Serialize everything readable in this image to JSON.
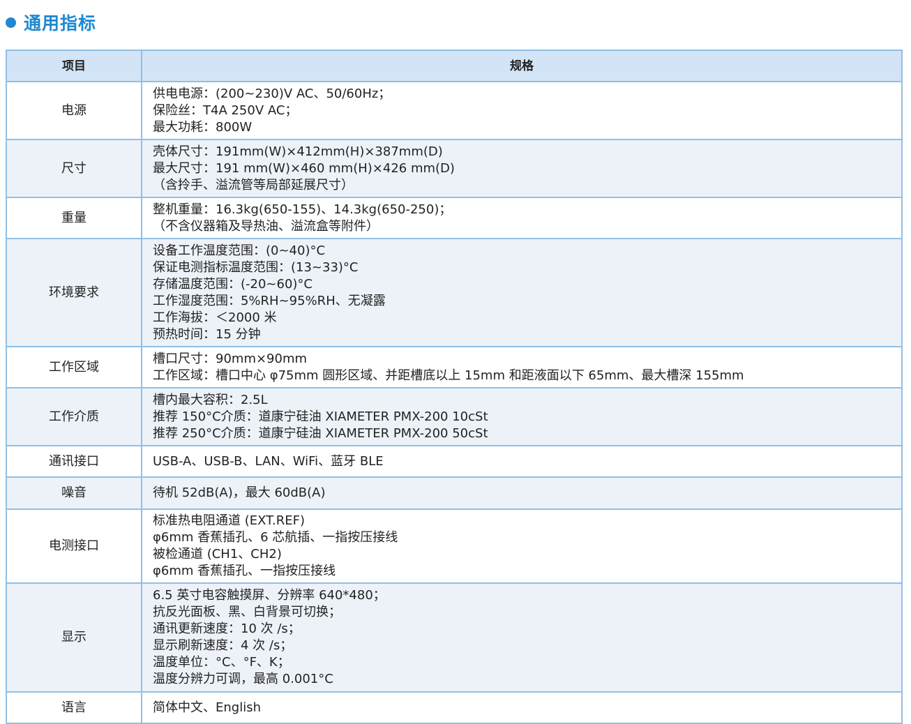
{
  "title": "通用指标",
  "accent": "#1e88d0",
  "header": {
    "item": "项目",
    "spec": "规格"
  },
  "rows": [
    {
      "item": "电源",
      "lines": [
        "供电电源：(200~230)V AC、50/60Hz；",
        "保险丝：T4A 250V AC；",
        "最大功耗：800W"
      ]
    },
    {
      "item": "尺寸",
      "lines": [
        "壳体尺寸：191mm(W)×412mm(H)×387mm(D)",
        "最大尺寸：191 mm(W)×460 mm(H)×426 mm(D)",
        "（含拎手、溢流管等局部延展尺寸）"
      ]
    },
    {
      "item": "重量",
      "lines": [
        "整机重量：16.3kg(650-155)、14.3kg(650-250)；",
        "（不含仪器箱及导热油、溢流盒等附件）"
      ]
    },
    {
      "item": "环境要求",
      "lines": [
        "设备工作温度范围：(0~40)°C",
        "保证电测指标温度范围：(13~33)°C",
        "存储温度范围：(-20~60)°C",
        "工作湿度范围：5%RH~95%RH、无凝露",
        "工作海拔：＜2000 米",
        "预热时间：15 分钟"
      ]
    },
    {
      "item": "工作区域",
      "lines": [
        "槽口尺寸：90mm×90mm",
        "工作区域：槽口中心 φ75mm 圆形区域、并距槽底以上 15mm 和距液面以下 65mm、最大槽深 155mm"
      ]
    },
    {
      "item": "工作介质",
      "lines": [
        "槽内最大容积：2.5L",
        "推荐 150°C介质：道康宁硅油 XIAMETER PMX-200 10cSt",
        "推荐 250°C介质：道康宁硅油 XIAMETER PMX-200 50cSt"
      ]
    },
    {
      "item": "通讯接口",
      "lines": [
        "USB-A、USB-B、LAN、WiFi、蓝牙 BLE"
      ]
    },
    {
      "item": "噪音",
      "lines": [
        "待机 52dB(A)，最大 60dB(A)"
      ]
    },
    {
      "item": "电测接口",
      "lines": [
        "标准热电阻通道 (EXT.REF)",
        "φ6mm 香蕉插孔、6 芯航插、一指按压接线",
        "被检通道 (CH1、CH2)",
        "φ6mm 香蕉插孔、一指按压接线"
      ]
    },
    {
      "item": "显示",
      "lines": [
        "6.5 英寸电容触摸屏、分辨率 640*480；",
        "抗反光面板、黑、白背景可切换；",
        "通讯更新速度：10 次 /s；",
        "显示刷新速度：4 次 /s；",
        "温度单位：°C、°F、K；",
        "温度分辨力可调，最高 0.001°C"
      ]
    },
    {
      "item": "语言",
      "lines": [
        "简体中文、English"
      ]
    }
  ]
}
